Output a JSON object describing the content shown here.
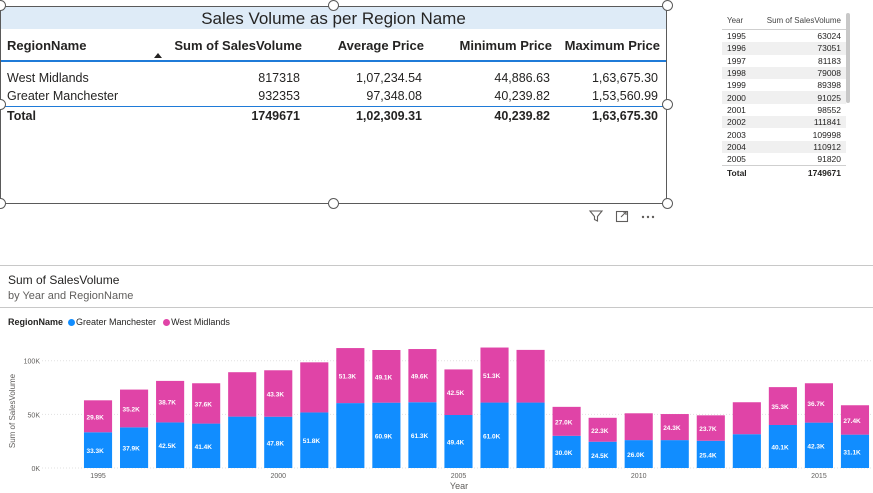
{
  "matrix": {
    "title": "Sales Volume as per Region Name",
    "headers": [
      "RegionName",
      "Sum of SalesVolume",
      "Average Price",
      "Minimum Price",
      "Maximum Price"
    ],
    "rows": [
      [
        "West Midlands",
        "817318",
        "1,07,234.54",
        "44,886.63",
        "1,63,675.30"
      ],
      [
        "Greater Manchester",
        "932353",
        "97,348.08",
        "40,239.82",
        "1,53,560.99"
      ]
    ],
    "total": [
      "Total",
      "1749671",
      "1,02,309.31",
      "40,239.82",
      "1,63,675.30"
    ]
  },
  "visual_tools": {
    "filter_icon": "filter-icon",
    "focus_icon": "focus-mode-icon",
    "more_icon": "more-options-icon"
  },
  "year_table": {
    "headers": [
      "Year",
      "Sum of SalesVolume"
    ],
    "rows": [
      [
        "1995",
        "63024"
      ],
      [
        "1996",
        "73051"
      ],
      [
        "1997",
        "81183"
      ],
      [
        "1998",
        "79008"
      ],
      [
        "1999",
        "89398"
      ],
      [
        "2000",
        "91025"
      ],
      [
        "2001",
        "98552"
      ],
      [
        "2002",
        "111841"
      ],
      [
        "2003",
        "109998"
      ],
      [
        "2004",
        "110912"
      ],
      [
        "2005",
        "91820"
      ]
    ],
    "total": [
      "Total",
      "1749671"
    ]
  },
  "chart": {
    "title": "Sum of SalesVolume",
    "subtitle": "by Year and RegionName",
    "legend_title": "RegionName",
    "legend": [
      "Greater Manchester",
      "West Midlands"
    ]
  },
  "colors": {
    "greater_manchester": "#118DFF",
    "west_midlands": "#E044A7",
    "accent": "#1F7BD8",
    "title_bg": "#DEEBF7"
  },
  "chart_data": {
    "type": "bar",
    "stacked": true,
    "xlabel": "Year",
    "ylabel": "Sum of SalesVolume",
    "ylim": [
      0,
      110000
    ],
    "yticks": [
      0,
      50000,
      100000
    ],
    "ytick_labels": [
      "0K",
      "50K",
      "100K"
    ],
    "xtick_labels": [
      "1995",
      "2000",
      "2005",
      "2010",
      "2015"
    ],
    "categories": [
      1995,
      1996,
      1997,
      1998,
      1999,
      2000,
      2001,
      2002,
      2003,
      2004,
      2005,
      2006,
      2007,
      2008,
      2009,
      2010,
      2011,
      2012,
      2013,
      2014,
      2015,
      2016
    ],
    "series": [
      {
        "name": "Greater Manchester",
        "values": [
          33300,
          37900,
          42500,
          41400,
          47900,
          47800,
          51800,
          60500,
          60900,
          61300,
          49400,
          61000,
          61000,
          30000,
          24500,
          26000,
          26000,
          25400,
          31500,
          40100,
          42300,
          31100
        ],
        "labels": [
          "33.3K",
          "37.9K",
          "42.5K",
          "41.4K",
          "",
          "47.8K",
          "51.8K",
          "",
          "60.9K",
          "61.3K",
          "49.4K",
          "61.0K",
          "",
          "30.0K",
          "24.5K",
          "26.0K",
          "",
          "25.4K",
          "",
          "40.1K",
          "42.3K",
          "31.1K"
        ]
      },
      {
        "name": "West Midlands",
        "values": [
          29800,
          35200,
          38700,
          37600,
          41400,
          43300,
          46700,
          51300,
          49100,
          49600,
          42500,
          51300,
          49100,
          27000,
          22300,
          25000,
          24300,
          23700,
          29800,
          35300,
          36700,
          27400
        ],
        "labels": [
          "29.8K",
          "35.2K",
          "38.7K",
          "37.6K",
          "",
          "43.3K",
          "",
          "51.3K",
          "49.1K",
          "49.6K",
          "42.5K",
          "51.3K",
          "",
          "27.0K",
          "22.3K",
          "",
          "24.3K",
          "23.7K",
          "",
          "35.3K",
          "36.7K",
          "27.4K"
        ]
      }
    ]
  }
}
